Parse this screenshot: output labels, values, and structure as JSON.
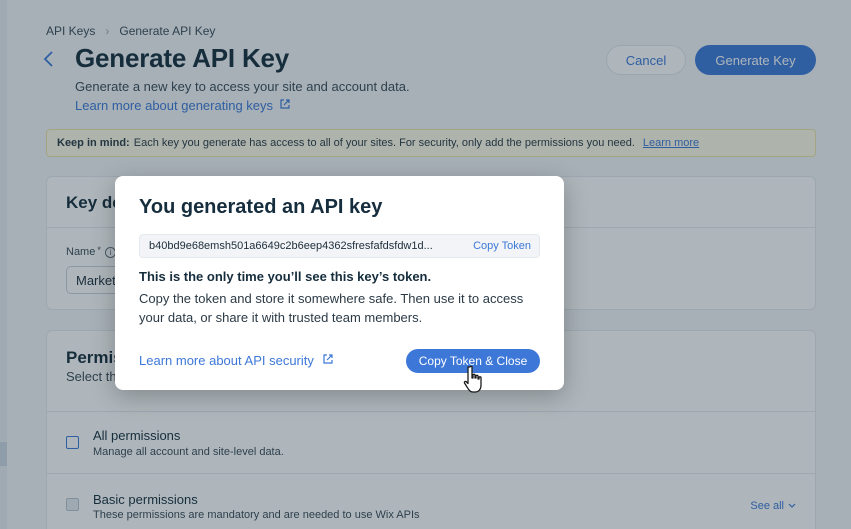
{
  "breadcrumb": {
    "root": "API Keys",
    "current": "Generate API Key"
  },
  "header": {
    "title": "Generate API Key",
    "subtitle": "Generate a new key to access your site and account data.",
    "learn_link": "Learn more about generating keys",
    "cancel_label": "Cancel",
    "generate_label": "Generate Key"
  },
  "banner": {
    "bold": "Keep in mind:",
    "text": "Each key you generate has access to all of your sites. For security, only add the permissions you need.",
    "link": "Learn more"
  },
  "details": {
    "title": "Key details",
    "name_label": "Name",
    "name_required": "*",
    "name_value": "Marketing"
  },
  "permissions": {
    "title": "Permissions",
    "subtitle": "Select the permissions",
    "rows": [
      {
        "title": "All permissions",
        "desc": "Manage all account and site-level data."
      },
      {
        "title": "Basic permissions",
        "desc": "These permissions are mandatory and are needed to use Wix APIs",
        "action": "See all"
      }
    ]
  },
  "modal": {
    "title": "You generated an API key",
    "token": "b40bd9e68emsh501a6649c2b6eep4362sfresfafdsfdw1d...",
    "copy_token_label": "Copy Token",
    "warn_bold": "This is the only time you’ll see this key’s token.",
    "warn_body": "Copy the token and store it somewhere safe. Then use it to access your data, or share it with trusted team members.",
    "security_link": "Learn more about API security",
    "copy_close_label": "Copy Token & Close"
  },
  "colors": {
    "accent": "#3d78d8",
    "title": "#162d3d",
    "banner": "#fffbe6"
  },
  "icons": [
    "chevron-right-icon",
    "back-arrow-icon",
    "external-link-icon",
    "info-icon",
    "chevron-down-icon",
    "hand-cursor-icon"
  ]
}
